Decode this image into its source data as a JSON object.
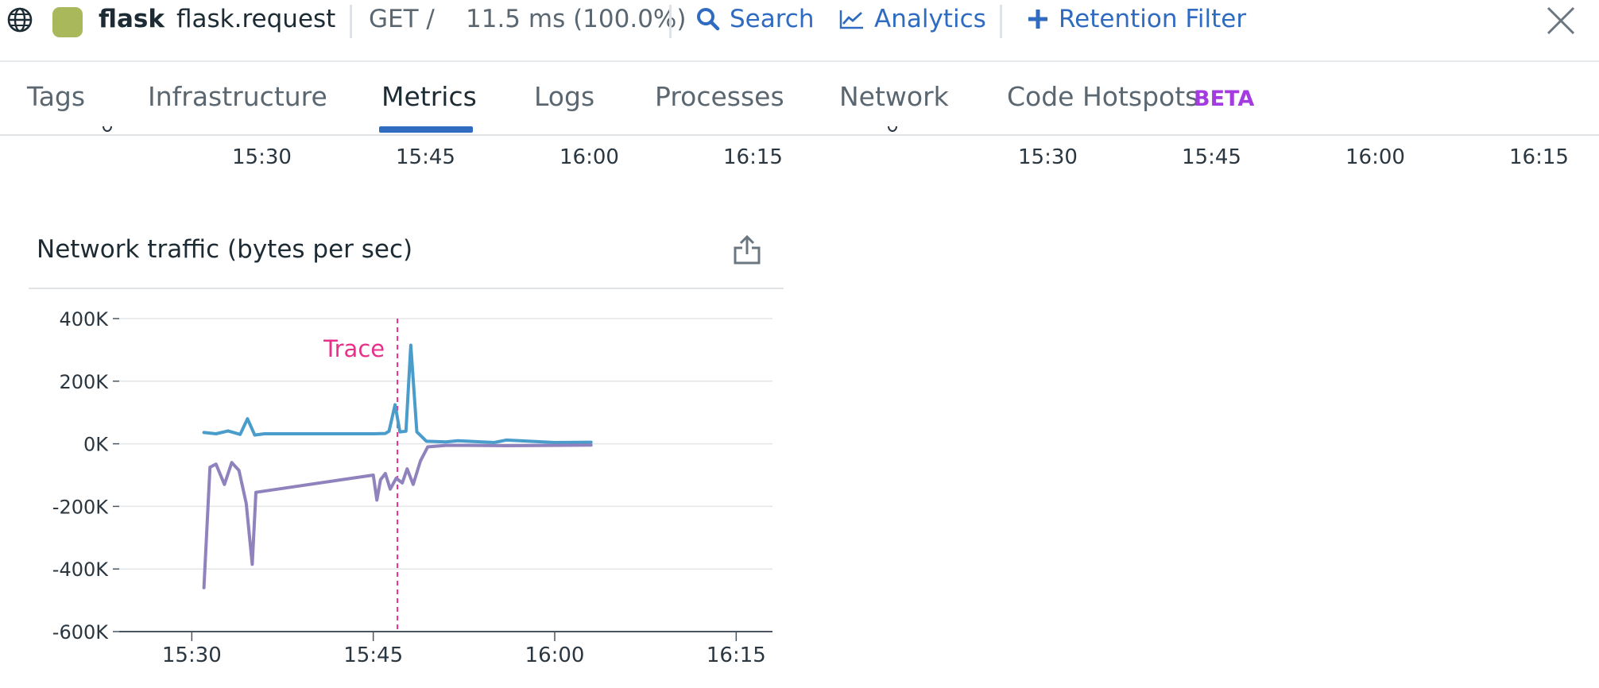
{
  "header": {
    "globe_icon": "globe-icon",
    "service_color": "#a8b85a",
    "service": "flask",
    "operation": "flask.request",
    "resource": "GET /",
    "duration": "11.5 ms (100.0%)",
    "actions": {
      "search": "Search",
      "analytics": "Analytics",
      "retention_filter": "Retention Filter"
    },
    "close_icon": "close-icon"
  },
  "tabs": {
    "items": [
      "Tags",
      "Infrastructure",
      "Metrics",
      "Logs",
      "Processes",
      "Network",
      "Code Hotspots"
    ],
    "active": "Metrics",
    "beta_badge": "BETA"
  },
  "upper_charts": {
    "left_ticks": [
      "15:30",
      "15:45",
      "16:00",
      "16:15"
    ],
    "right_ticks": [
      "15:30",
      "15:45",
      "16:00",
      "16:15"
    ]
  },
  "network_widget": {
    "title": "Network traffic (bytes per sec)",
    "export_icon": "export-icon"
  },
  "chart_data": {
    "type": "line",
    "title": "Network traffic (bytes per sec)",
    "xlabel": "",
    "ylabel": "",
    "y_ticks": [
      "400K",
      "200K",
      "0K",
      "-200K",
      "-400K",
      "-600K"
    ],
    "x_ticks": [
      "15:30",
      "15:45",
      "16:00",
      "16:15"
    ],
    "ylim": [
      -600000,
      400000
    ],
    "xlim": [
      "15:24",
      "16:18"
    ],
    "grid": true,
    "marker": {
      "label": "Trace",
      "x": "15:47",
      "color": "#e8308a"
    },
    "series": [
      {
        "color": "#4a9ccb",
        "points": [
          [
            "15:31",
            36000
          ],
          [
            "15:32",
            32000
          ],
          [
            "15:33",
            41000
          ],
          [
            "15:34",
            30000
          ],
          [
            "15:34.6",
            80000
          ],
          [
            "15:35.2",
            28000
          ],
          [
            "15:36",
            32000
          ],
          [
            "15:40",
            32000
          ],
          [
            "15:45",
            32000
          ],
          [
            "15:46",
            33000
          ],
          [
            "15:46.3",
            40000
          ],
          [
            "15:46.8",
            125000
          ],
          [
            "15:47.2",
            38000
          ],
          [
            "15:47.7",
            40000
          ],
          [
            "15:48.1",
            315000
          ],
          [
            "15:48.6",
            38000
          ],
          [
            "15:49.4",
            8000
          ],
          [
            "15:51",
            6000
          ],
          [
            "15:52",
            10000
          ],
          [
            "15:55",
            4000
          ],
          [
            "15:56",
            12000
          ],
          [
            "16:00",
            4000
          ],
          [
            "16:03",
            5000
          ]
        ]
      },
      {
        "color": "#8f82bd",
        "points": [
          [
            "15:31",
            -460000
          ],
          [
            "15:31.5",
            -75000
          ],
          [
            "15:32",
            -65000
          ],
          [
            "15:32.7",
            -130000
          ],
          [
            "15:33.3",
            -60000
          ],
          [
            "15:33.9",
            -85000
          ],
          [
            "15:34.5",
            -190000
          ],
          [
            "15:35",
            -385000
          ],
          [
            "15:35.3",
            -155000
          ],
          [
            "15:45",
            -100000
          ],
          [
            "15:45.3",
            -180000
          ],
          [
            "15:45.6",
            -115000
          ],
          [
            "15:46",
            -95000
          ],
          [
            "15:46.4",
            -145000
          ],
          [
            "15:46.9",
            -110000
          ],
          [
            "15:47.4",
            -125000
          ],
          [
            "15:47.8",
            -80000
          ],
          [
            "15:48.3",
            -130000
          ],
          [
            "15:48.9",
            -55000
          ],
          [
            "15:49.5",
            -10000
          ],
          [
            "15:51",
            -5000
          ],
          [
            "15:53",
            -5000
          ],
          [
            "15:56",
            -6000
          ],
          [
            "16:00",
            -5000
          ],
          [
            "16:03",
            -4000
          ]
        ]
      }
    ]
  }
}
